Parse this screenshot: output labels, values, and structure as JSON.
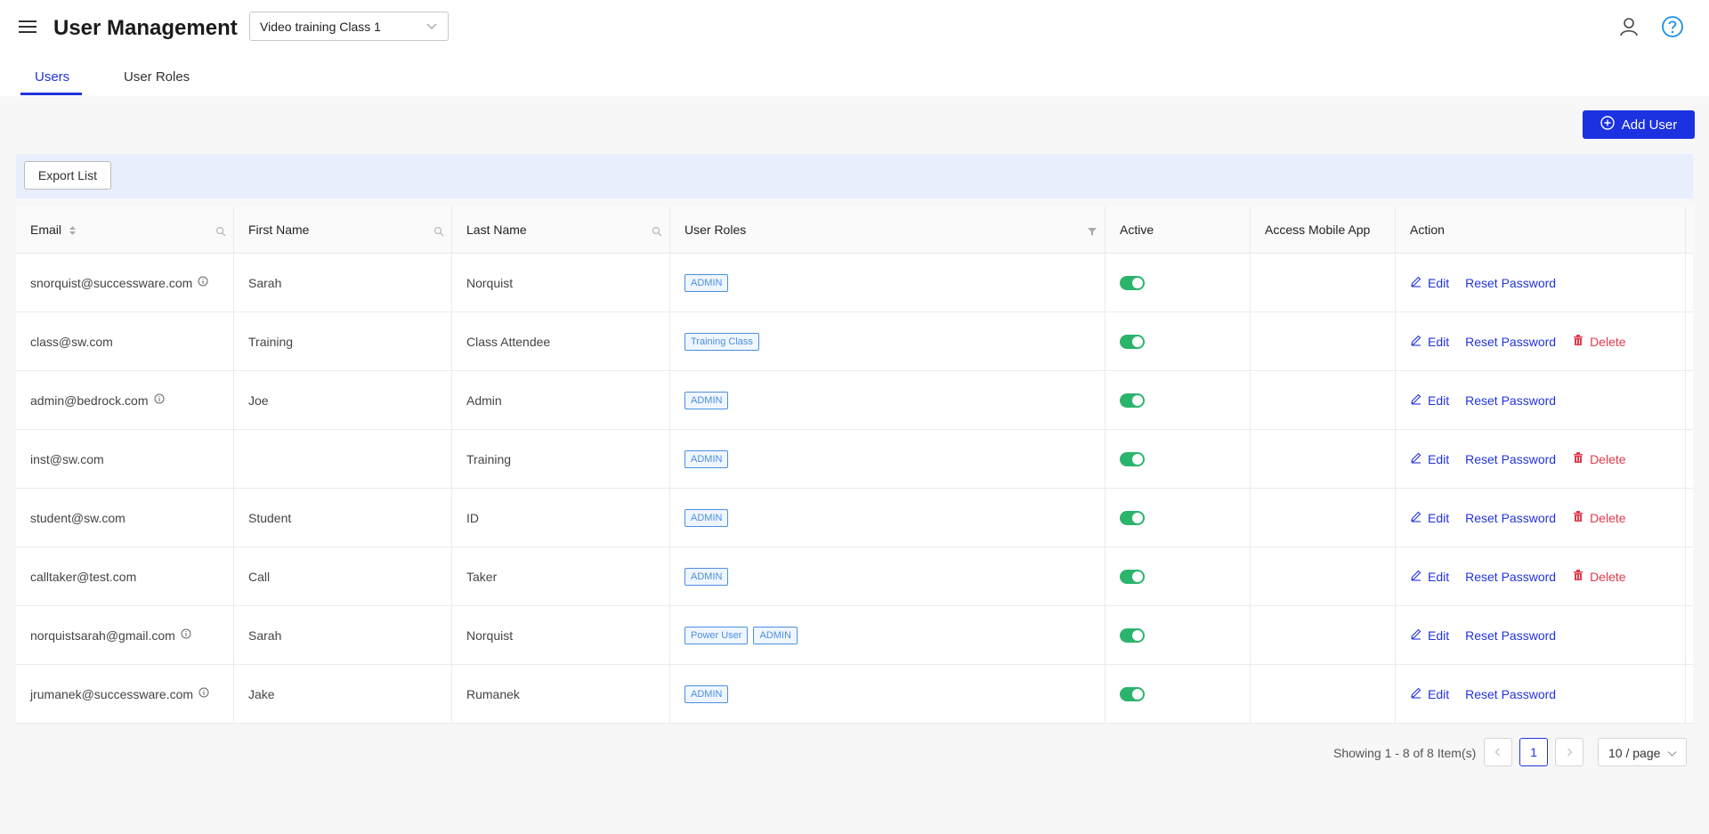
{
  "header": {
    "title": "User Management",
    "class_select": "Video training Class 1"
  },
  "tabs": [
    {
      "label": "Users",
      "active": true
    },
    {
      "label": "User Roles",
      "active": false
    }
  ],
  "toolbar": {
    "add_user_label": "Add User",
    "export_label": "Export List"
  },
  "table": {
    "columns": [
      "Email",
      "First Name",
      "Last Name",
      "User Roles",
      "Active",
      "Access Mobile App",
      "Action"
    ],
    "rows": [
      {
        "email": "snorquist@successware.com",
        "info": true,
        "first": "Sarah",
        "last": "Norquist",
        "roles": [
          "ADMIN"
        ],
        "active": true,
        "delete": false
      },
      {
        "email": "class@sw.com",
        "info": false,
        "first": "Training",
        "last": "Class Attendee",
        "roles": [
          "Training Class"
        ],
        "active": true,
        "delete": true
      },
      {
        "email": "admin@bedrock.com",
        "info": true,
        "first": "Joe",
        "last": "Admin",
        "roles": [
          "ADMIN"
        ],
        "active": true,
        "delete": false
      },
      {
        "email": "inst@sw.com",
        "info": false,
        "first": "",
        "last": "Training",
        "roles": [
          "ADMIN"
        ],
        "active": true,
        "delete": true
      },
      {
        "email": "student@sw.com",
        "info": false,
        "first": "Student",
        "last": "ID",
        "roles": [
          "ADMIN"
        ],
        "active": true,
        "delete": true
      },
      {
        "email": "calltaker@test.com",
        "info": false,
        "first": "Call",
        "last": "Taker",
        "roles": [
          "ADMIN"
        ],
        "active": true,
        "delete": true
      },
      {
        "email": "norquistsarah@gmail.com",
        "info": true,
        "first": "Sarah",
        "last": "Norquist",
        "roles": [
          "Power User",
          "ADMIN"
        ],
        "active": true,
        "delete": false
      },
      {
        "email": "jrumanek@successware.com",
        "info": true,
        "first": "Jake",
        "last": "Rumanek",
        "roles": [
          "ADMIN"
        ],
        "active": true,
        "delete": false
      }
    ],
    "actions": {
      "edit": "Edit",
      "reset": "Reset Password",
      "delete": "Delete"
    }
  },
  "pagination": {
    "showing": "Showing 1 - 8 of 8 Item(s)",
    "current_page": "1",
    "page_size": "10 / page"
  },
  "colors": {
    "primary": "#1c31e0",
    "danger": "#e23a4c",
    "toggle_on": "#2bb46c",
    "tag": "#4a8fe0"
  }
}
